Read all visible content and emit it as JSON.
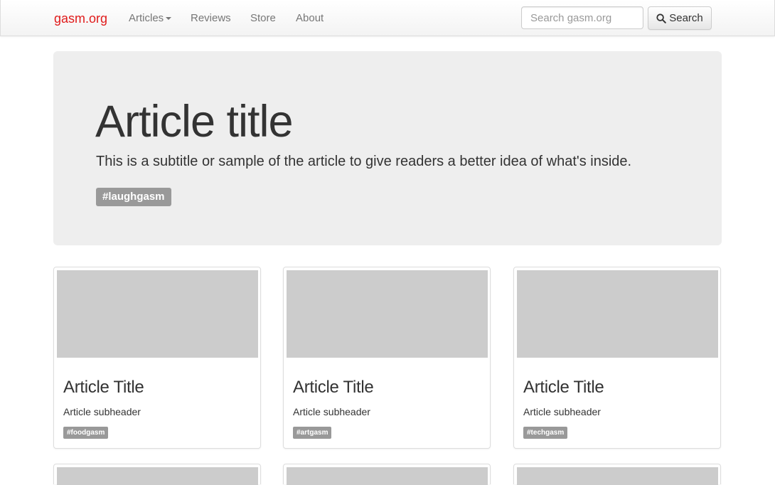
{
  "navbar": {
    "brand": "gasm.org",
    "links": [
      {
        "label": "Articles",
        "dropdown": true
      },
      {
        "label": "Reviews"
      },
      {
        "label": "Store"
      },
      {
        "label": "About"
      }
    ],
    "search": {
      "placeholder": "Search gasm.org",
      "value": "",
      "button_label": "Search",
      "icon": "search-icon"
    }
  },
  "hero": {
    "title": "Article title",
    "subtitle": "This is a subtitle or sample of the article to give readers a better idea of what's inside.",
    "tag": "#laughgasm"
  },
  "cards": [
    {
      "title": "Article Title",
      "subheader": "Article subheader",
      "tag": "#foodgasm"
    },
    {
      "title": "Article Title",
      "subheader": "Article subheader",
      "tag": "#artgasm"
    },
    {
      "title": "Article Title",
      "subheader": "Article subheader",
      "tag": "#techgasm"
    }
  ],
  "colors": {
    "brand": "#e01b1b",
    "jumbotron_bg": "#eeeeee",
    "tag_bg": "#999999",
    "placeholder_image": "#cccccc"
  }
}
